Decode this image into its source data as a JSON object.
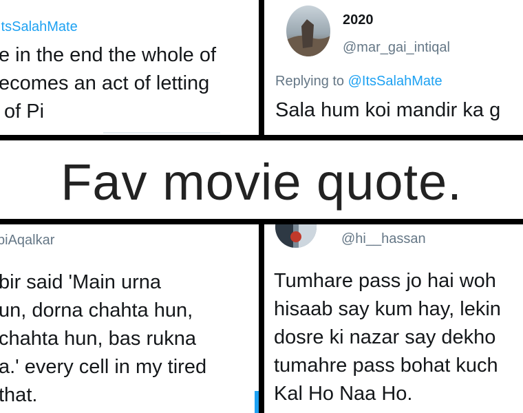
{
  "top_left": {
    "handle": "ItsSalahMate",
    "lines": [
      "e in the end the whole of",
      "ecomes an act of letting",
      " of Pi"
    ]
  },
  "top_right": {
    "name": "2020",
    "handle": "@mar_gai_intiqal",
    "replying_label": "Replying to",
    "replying_handle": "@ItsSalahMate",
    "lines": [
      "Sala hum koi mandir ka g"
    ]
  },
  "banner": {
    "title": "Fav movie quote."
  },
  "bottom_left": {
    "handle": "biAqalkar",
    "lines": [
      "bir said 'Main urna",
      "un, dorna chahta hun,",
      "chahta hun, bas rukna",
      "a.' every cell in my tired",
      "that."
    ]
  },
  "bottom_right": {
    "handle": "@hi__hassan",
    "lines": [
      "Tumhare pass jo hai woh",
      "hisaab say kum hay, lekin",
      "dosre ki nazar say dekho",
      "tumahre pass bohat kuch",
      "Kal Ho Naa Ho."
    ]
  },
  "colors": {
    "link_blue": "#1da1f2",
    "text_dark": "#14171a",
    "text_grey": "#657786",
    "divider": "#000000"
  }
}
